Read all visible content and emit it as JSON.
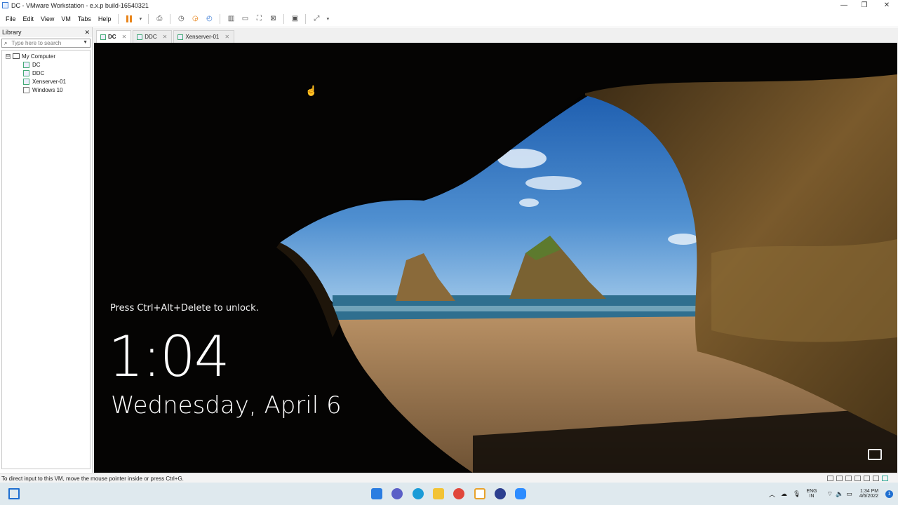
{
  "window": {
    "title": "DC - VMware Workstation - e.x.p build-16540321",
    "controls": {
      "minimize": "—",
      "restore": "❐",
      "close": "✕"
    }
  },
  "menu": [
    "File",
    "Edit",
    "View",
    "VM",
    "Tabs",
    "Help"
  ],
  "toolbar_icons": [
    "pause-icon",
    "dropdown-icon",
    "send-ctrl-alt-del-icon",
    "snapshot-icon",
    "revert-snapshot-icon",
    "snapshot-manager-icon",
    "show-library-icon",
    "thumbnail-bar-icon",
    "full-screen-icon",
    "unity-icon",
    "console-view-icon",
    "stretch-guest-icon"
  ],
  "library": {
    "title": "Library",
    "close": "✕",
    "search_placeholder": "Type here to search",
    "root": {
      "label": "My Computer",
      "expander": "⊟"
    },
    "items": [
      {
        "label": "DC",
        "state": "on"
      },
      {
        "label": "DDC",
        "state": "on"
      },
      {
        "label": "Xenserver-01",
        "state": "on"
      },
      {
        "label": "Windows 10",
        "state": "off"
      }
    ]
  },
  "tabs": [
    {
      "label": "DC",
      "active": true,
      "close": "✕"
    },
    {
      "label": "DDC",
      "active": false,
      "close": "✕"
    },
    {
      "label": "Xenserver-01",
      "active": false,
      "close": "✕"
    }
  ],
  "lockscreen": {
    "message": "Press Ctrl+Alt+Delete to unlock.",
    "time": "1:04",
    "date": "Wednesday, April 6"
  },
  "statusbar": {
    "hint": "To direct input to this VM, move the mouse pointer inside or press Ctrl+G."
  },
  "taskbar": {
    "lang_top": "ENG",
    "lang_bottom": "IN",
    "clock_time": "1:34 PM",
    "clock_date": "4/6/2022",
    "notification_count": "1"
  },
  "colors": {
    "pause": "#e8841a",
    "taskbar": "#dfe9ee",
    "lockscreen_bg": "#030303"
  }
}
